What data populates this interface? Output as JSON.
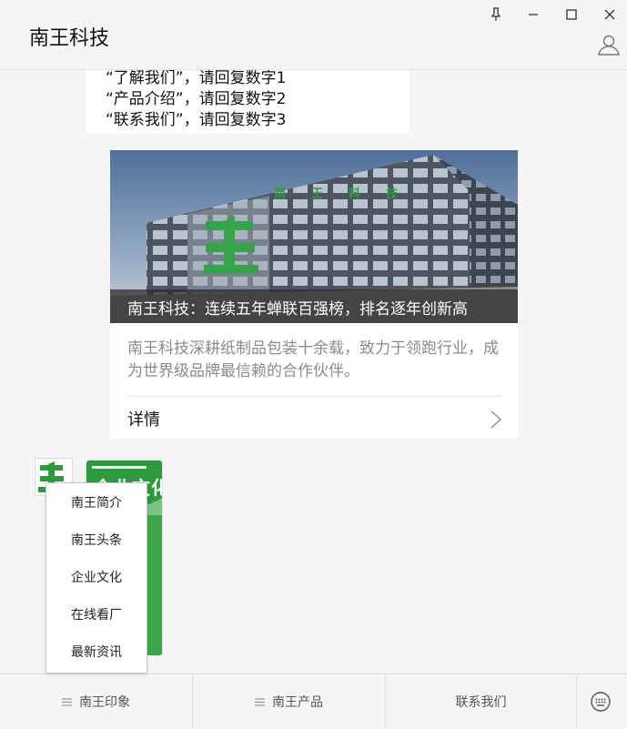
{
  "window": {
    "title": "南王科技"
  },
  "chat": {
    "text_lines": [
      "“了解我们”，请回复数字1",
      "“产品介绍”，请回复数字2",
      "“联系我们”，请回复数字3"
    ],
    "article": {
      "banner_text": "南王科技",
      "title": "南王科技：连续五年蝉联百强榜，排名逐年创新高",
      "description": "南王科技深耕纸制品包装十余载，致力于领跑行业，成为世界级品牌最信赖的合作伙伴。",
      "detail_label": "详情"
    },
    "image_msg": {
      "heading": "企业文化"
    }
  },
  "menu_popup": {
    "items": [
      "南王简介",
      "南王头条",
      "企业文化",
      "在线看厂",
      "最新资讯"
    ]
  },
  "bottom_menu": {
    "tabs": [
      "南王印象",
      "南王产品",
      "联系我们"
    ]
  },
  "colors": {
    "brand_green": "#2e9a3e",
    "background": "#f5f5f5"
  }
}
